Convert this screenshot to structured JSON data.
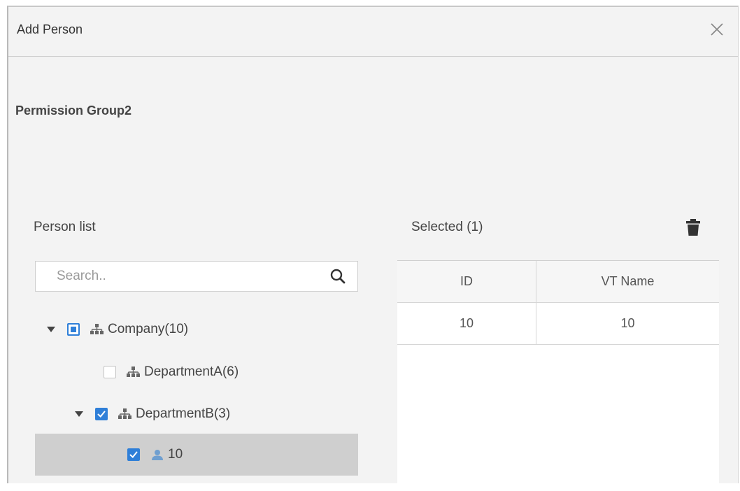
{
  "dialog": {
    "title": "Add Person",
    "close_icon": "close-icon"
  },
  "group": {
    "name": "Permission Group2"
  },
  "person_list": {
    "label": "Person list",
    "search": {
      "placeholder": "Search..",
      "value": "",
      "icon": "search-icon"
    },
    "tree": [
      {
        "label": "Company(10)",
        "expanded": true,
        "check_state": "partial",
        "icon": "org-icon"
      },
      {
        "label": "DepartmentA(6)",
        "expanded": false,
        "check_state": "unchecked",
        "icon": "org-icon"
      },
      {
        "label": "DepartmentB(3)",
        "expanded": true,
        "check_state": "checked",
        "icon": "org-icon"
      },
      {
        "label": "10",
        "check_state": "checked",
        "icon": "user-icon",
        "highlighted": true
      }
    ]
  },
  "selected": {
    "label": "Selected (1)",
    "delete_icon": "trash-icon",
    "columns": [
      "ID",
      "VT Name"
    ],
    "rows": [
      [
        "10",
        "10"
      ]
    ]
  },
  "colors": {
    "accent": "#2f7fd8",
    "dialog_bg": "#f3f3f3",
    "selected_row": "#cfcfcf"
  }
}
